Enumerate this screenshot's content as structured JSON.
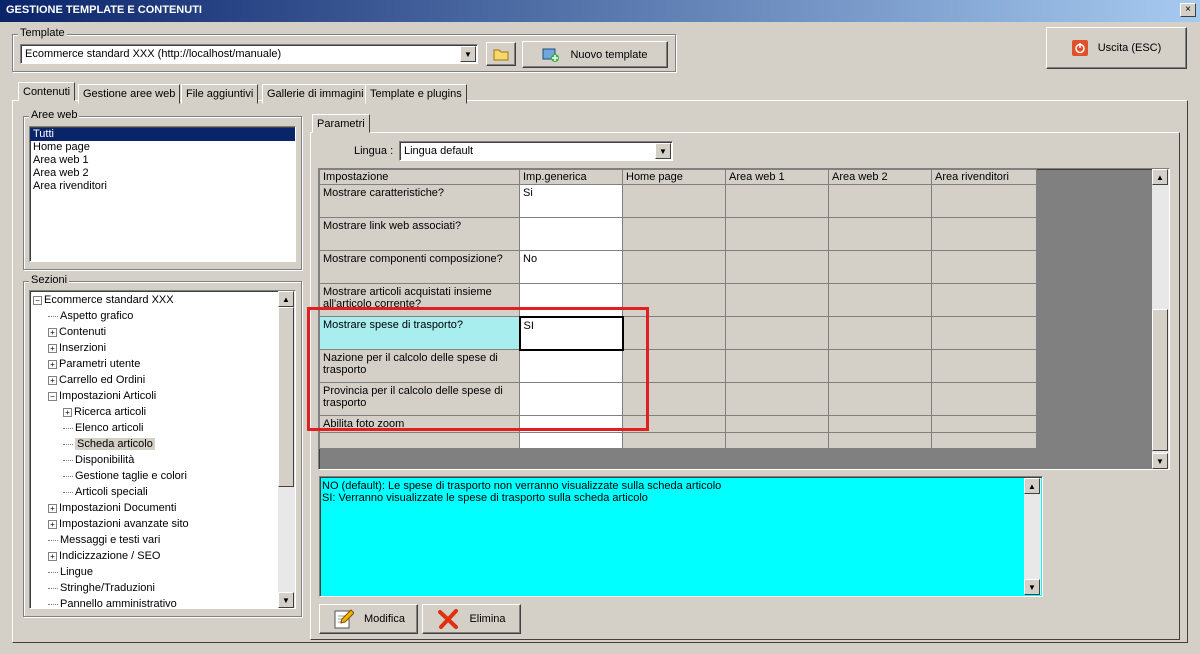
{
  "window": {
    "title": "GESTIONE TEMPLATE E CONTENUTI",
    "close": "×"
  },
  "template_group": {
    "legend": "Template",
    "selected": "Ecommerce standard XXX (http://localhost/manuale)",
    "new_button": "Nuovo template"
  },
  "exit_button": "Uscita (ESC)",
  "tabs": [
    "Contenuti",
    "Gestione aree web",
    "File aggiuntivi",
    "Gallerie di immagini",
    "Template e plugins"
  ],
  "aree_web": {
    "legend": "Aree web",
    "items": [
      "Tutti",
      "Home page",
      "Area web 1",
      "Area web 2",
      "Area rivenditori"
    ]
  },
  "sezioni": {
    "legend": "Sezioni",
    "tree": [
      {
        "label": "Ecommerce standard XXX",
        "level": 0,
        "exp": "−"
      },
      {
        "label": "Aspetto grafico",
        "level": 1,
        "exp": ""
      },
      {
        "label": "Contenuti",
        "level": 1,
        "exp": "+"
      },
      {
        "label": "Inserzioni",
        "level": 1,
        "exp": "+"
      },
      {
        "label": "Parametri utente",
        "level": 1,
        "exp": "+"
      },
      {
        "label": "Carrello ed Ordini",
        "level": 1,
        "exp": "+"
      },
      {
        "label": "Impostazioni Articoli",
        "level": 1,
        "exp": "−"
      },
      {
        "label": "Ricerca articoli",
        "level": 2,
        "exp": "+"
      },
      {
        "label": "Elenco articoli",
        "level": 2,
        "exp": ""
      },
      {
        "label": "Scheda articolo",
        "level": 2,
        "exp": "",
        "selected": true
      },
      {
        "label": "Disponibilità",
        "level": 2,
        "exp": ""
      },
      {
        "label": "Gestione taglie e colori",
        "level": 2,
        "exp": ""
      },
      {
        "label": "Articoli speciali",
        "level": 2,
        "exp": ""
      },
      {
        "label": "Impostazioni Documenti",
        "level": 1,
        "exp": "+"
      },
      {
        "label": "Impostazioni avanzate sito",
        "level": 1,
        "exp": "+"
      },
      {
        "label": "Messaggi e testi vari",
        "level": 1,
        "exp": ""
      },
      {
        "label": "Indicizzazione / SEO",
        "level": 1,
        "exp": "+"
      },
      {
        "label": "Lingue",
        "level": 1,
        "exp": ""
      },
      {
        "label": "Stringhe/Traduzioni",
        "level": 1,
        "exp": ""
      },
      {
        "label": "Pannello amministrativo",
        "level": 1,
        "exp": ""
      }
    ]
  },
  "parametri": {
    "tab": "Parametri",
    "lingua_label": "Lingua :",
    "lingua_value": "Lingua default",
    "columns": [
      "Impostazione",
      "Imp.generica",
      "Home page",
      "Area web 1",
      "Area web 2",
      "Area rivenditori"
    ],
    "rows": [
      {
        "name": "Mostrare caratteristiche?",
        "value": "Si"
      },
      {
        "name": "Mostrare link web associati?",
        "value": ""
      },
      {
        "name": "Mostrare componenti composizione?",
        "value": "No"
      },
      {
        "name": "Mostrare articoli acquistati insieme all'articolo corrente?",
        "value": ""
      },
      {
        "name": "Mostrare spese di trasporto?",
        "value": "SI",
        "selected": true
      },
      {
        "name": "Nazione per il calcolo delle spese di trasporto",
        "value": ""
      },
      {
        "name": "Provincia per il calcolo delle spese di trasporto",
        "value": ""
      },
      {
        "name": "Abilita foto zoom",
        "value": ""
      }
    ],
    "description": [
      "NO (default): Le spese di trasporto non verranno visualizzate sulla scheda articolo",
      "SI: Verranno visualizzate le spese di trasporto sulla scheda articolo"
    ],
    "modifica_button": "Modifica",
    "elimina_button": "Elimina"
  },
  "colors": {
    "highlight": "#0a246a",
    "desc_bg": "#00ffff",
    "selected_row": "#a8eeee",
    "annotation": "#e02020"
  }
}
